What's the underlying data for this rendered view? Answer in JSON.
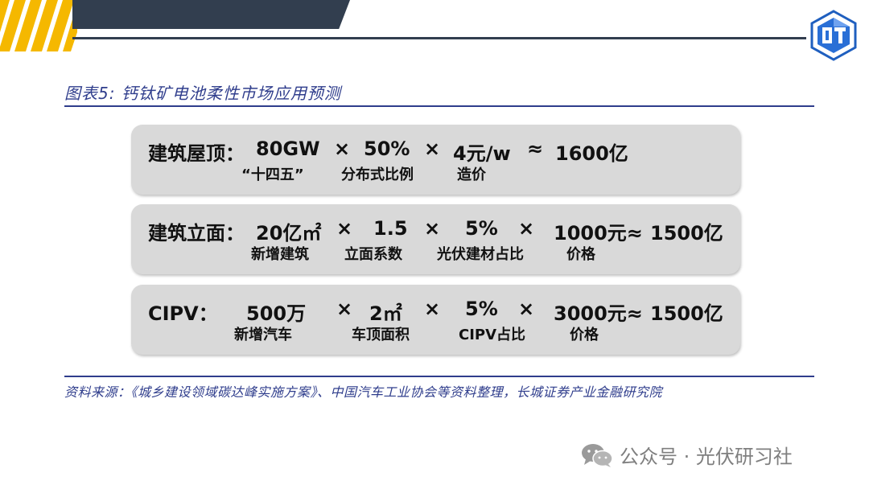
{
  "figure": {
    "caption": "图表5: 钙钛矿电池柔性市场应用预测"
  },
  "rows": [
    {
      "formula": [
        "建筑屋顶：",
        "80GW",
        "×",
        "50%",
        "×",
        "4元/w",
        "≈",
        "1600亿"
      ],
      "labels": [
        "“十四五”",
        "分布式比例",
        "造价"
      ]
    },
    {
      "formula": [
        "建筑立面：",
        "20亿㎡",
        "×",
        "1.5",
        "×",
        "5%",
        "×",
        "1000元≈",
        "1500亿"
      ],
      "labels": [
        "新增建筑",
        "立面系数",
        "光伏建材占比",
        "价格"
      ]
    },
    {
      "formula": [
        "CIPV：",
        "500万",
        "×",
        "2㎡",
        "×",
        "5%",
        "×",
        "3000元≈",
        "1500亿"
      ],
      "labels": [
        "新增汽车",
        "车顶面积",
        "CIPV占比",
        "价格"
      ]
    }
  ],
  "source": "资料来源：《城乡建设领域碳达峰实施方案》、中国汽车工业协会等资料整理，长城证券产业金融研究院",
  "watermark": {
    "icon": "wechat-icon",
    "text": "公众号 · 光伏研习社"
  },
  "colors": {
    "accent_yellow": "#f5b800",
    "header_dark": "#323e4f",
    "caption_blue": "#2f3d8c",
    "box_gray": "#d9d9d9"
  }
}
